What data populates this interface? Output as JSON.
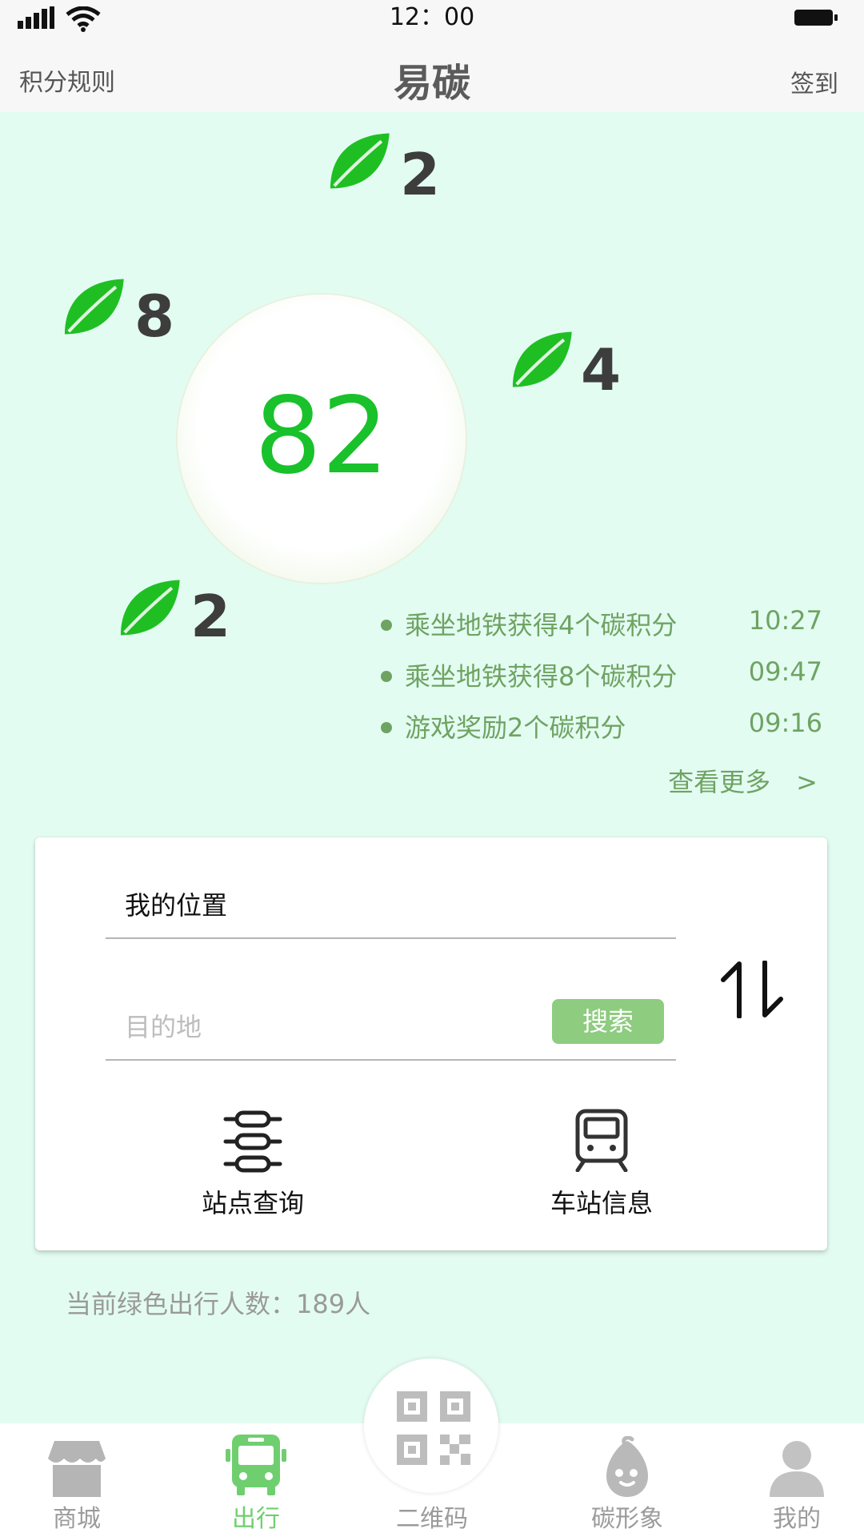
{
  "status_bar": {
    "time": "12：00"
  },
  "header": {
    "left": "积分规则",
    "title": "易碳",
    "right": "签到"
  },
  "score": {
    "value": "82"
  },
  "bubbles": [
    {
      "value": "2",
      "icon": "leaf-icon"
    },
    {
      "value": "8",
      "icon": "leaf-icon"
    },
    {
      "value": "4",
      "icon": "leaf-icon"
    },
    {
      "value": "2",
      "icon": "leaf-icon"
    }
  ],
  "feed": [
    {
      "text": "乘坐地铁获得4个碳积分",
      "time": "10:27"
    },
    {
      "text": "乘坐地铁获得8个碳积分",
      "time": "09:47"
    },
    {
      "text": "游戏奖励2个碳积分",
      "time": "09:16"
    }
  ],
  "feed_more": "查看更多　>",
  "route": {
    "origin_value": "我的位置",
    "destination_placeholder": "目的地",
    "search_label": "搜索"
  },
  "functions": [
    {
      "label": "站点查询",
      "icon": "station-list-icon"
    },
    {
      "label": "车站信息",
      "icon": "train-icon"
    }
  ],
  "green_travel": "当前绿色出行人数：189人",
  "tabs": [
    {
      "label": "商城",
      "icon": "shop-icon",
      "active": false
    },
    {
      "label": "出行",
      "icon": "bus-icon",
      "active": true
    },
    {
      "label": "二维码",
      "icon": "qr-code-icon",
      "active": false
    },
    {
      "label": "碳形象",
      "icon": "mascot-icon",
      "active": false
    },
    {
      "label": "我的",
      "icon": "user-icon",
      "active": false
    }
  ],
  "colors": {
    "accent_green": "#19c12b",
    "feed_green": "#6fa362",
    "button_green": "#8ecc7f",
    "tab_active": "#6fcf6f",
    "background": "#e3fcf2"
  }
}
